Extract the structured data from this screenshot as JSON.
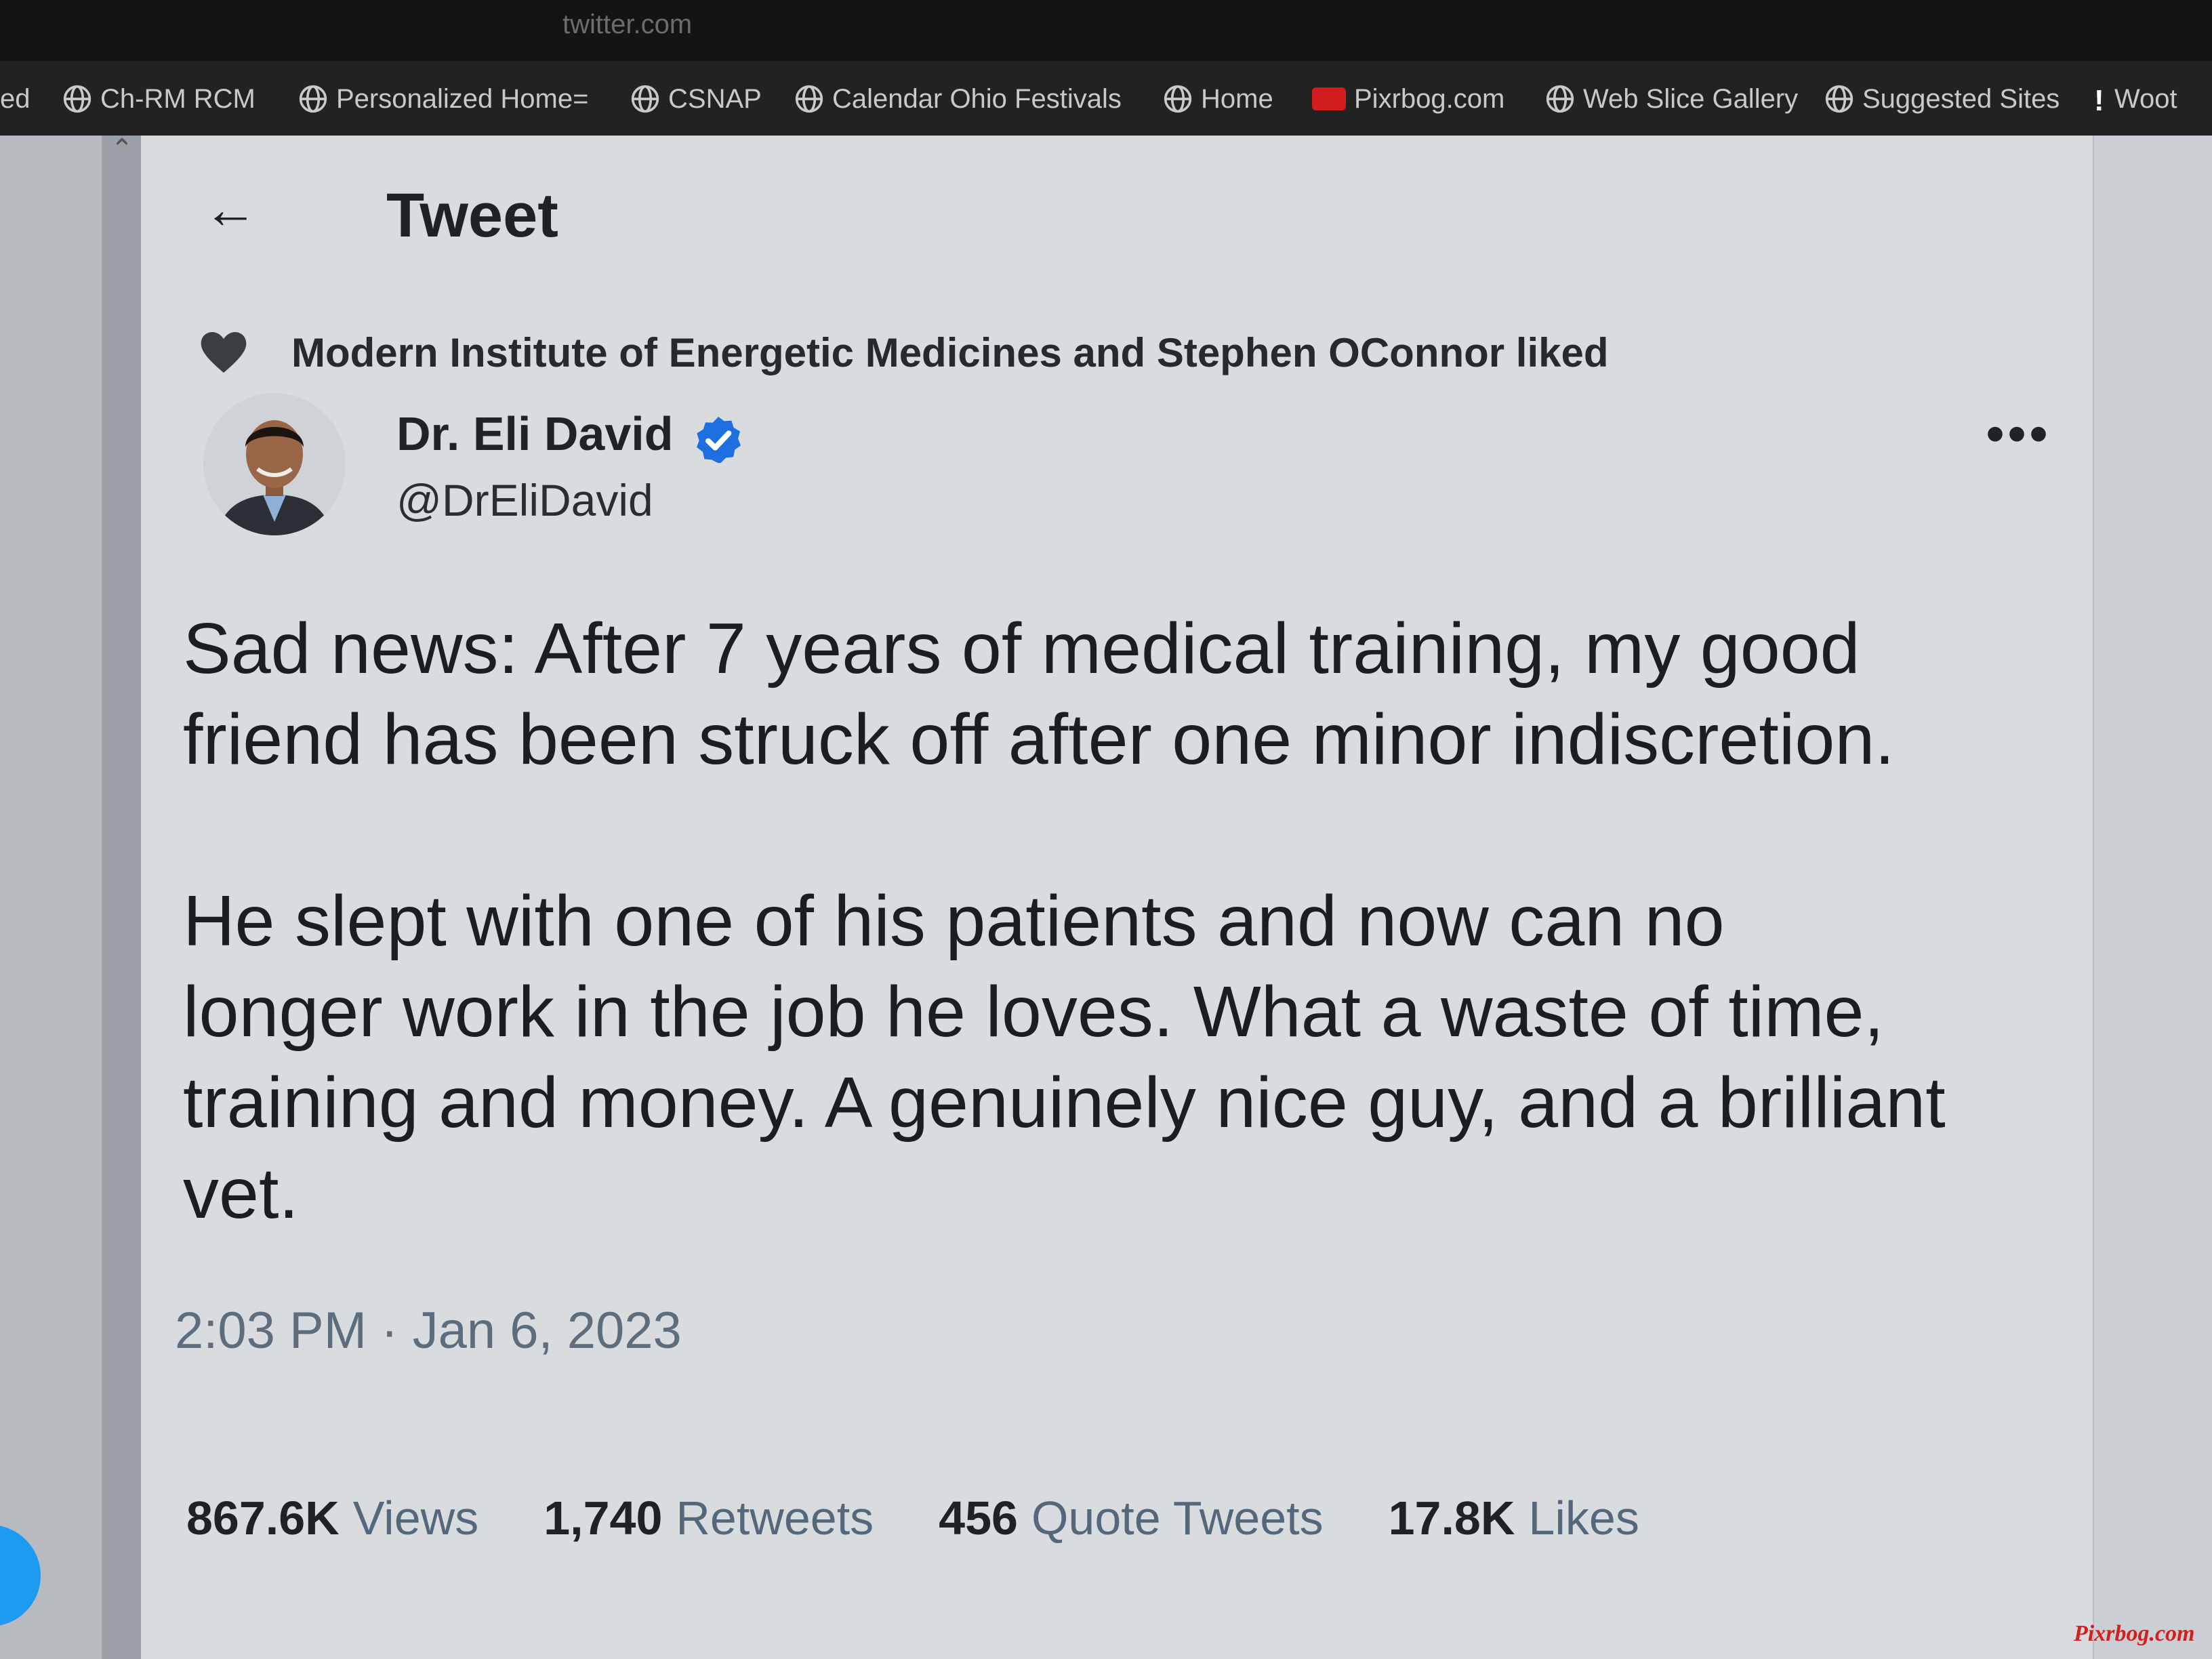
{
  "browser": {
    "url": "twitter.com",
    "bookmarks": [
      {
        "label": "ed",
        "icon": "none"
      },
      {
        "label": "Ch-RM RCM",
        "icon": "globe-icon"
      },
      {
        "label": "Personalized Home=",
        "icon": "globe-icon"
      },
      {
        "label": "CSNAP",
        "icon": "globe-icon"
      },
      {
        "label": "Calendar Ohio Festivals",
        "icon": "globe-icon"
      },
      {
        "label": "Home",
        "icon": "globe-icon"
      },
      {
        "label": "Pixrbog.com",
        "icon": "youtube-icon"
      },
      {
        "label": "Web Slice Gallery",
        "icon": "globe-icon"
      },
      {
        "label": "Suggested Sites",
        "icon": "globe-icon"
      },
      {
        "label": "Woot",
        "icon": "exclamation-icon"
      }
    ]
  },
  "header": {
    "title": "Tweet",
    "back_icon": "arrow-left-icon"
  },
  "social_context": {
    "icon": "heart-icon",
    "text": "Modern Institute of Energetic Medicines and Stephen OConnor liked"
  },
  "author": {
    "name": "Dr. Eli David",
    "handle": "@DrEliDavid",
    "verified": true,
    "verified_color": "#1d9bf0"
  },
  "tweet": {
    "paragraphs": [
      "Sad news: After 7 years of medical training, my good\nfriend has been struck off after one minor indiscretion.",
      "He slept with one of his patients and now can no\nlonger work in the job he loves. What a waste of time,\ntraining and money. A genuinely nice guy, and a brilliant\nvet."
    ],
    "timestamp": "2:03 PM · Jan 6, 2023"
  },
  "stats": [
    {
      "value": "867.6K",
      "label": "Views"
    },
    {
      "value": "1,740",
      "label": "Retweets"
    },
    {
      "value": "456",
      "label": "Quote Tweets"
    },
    {
      "value": "17.8K",
      "label": "Likes"
    }
  ],
  "watermark": "Pixrbog.com",
  "colors": {
    "accent": "#1d9bf0",
    "text": "#0f1419",
    "muted": "#536471"
  }
}
